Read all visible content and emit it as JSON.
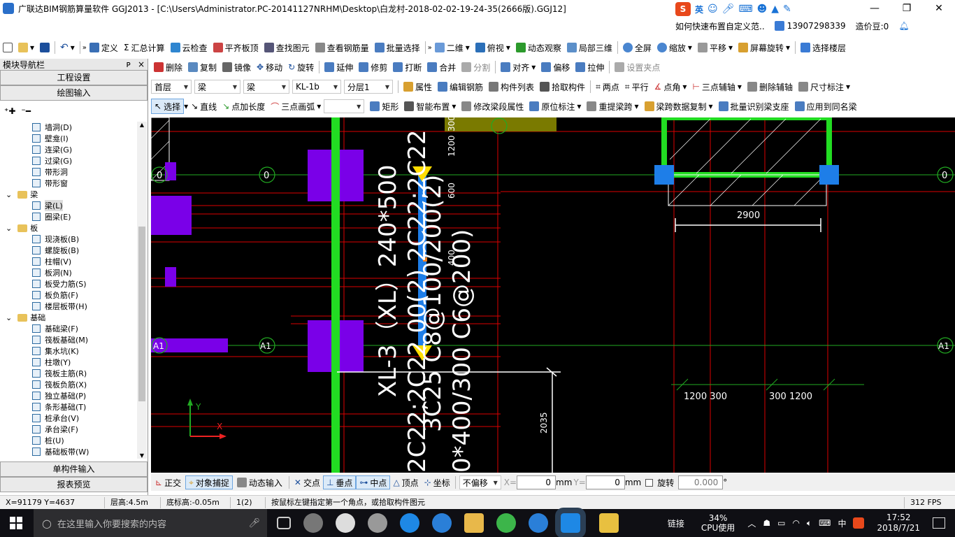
{
  "window": {
    "title": "广联达BIM钢筋算量软件 GGJ2013 - [C:\\Users\\Administrator.PC-20141127NRHM\\Desktop\\白龙村-2018-02-02-19-24-35(2666版).GGJ12]",
    "min": "—",
    "max": "❐",
    "close": "✕"
  },
  "ime": {
    "logo": "S",
    "lang": "英"
  },
  "hint": {
    "text": "如何快速布置自定义范..",
    "phone": "13907298339",
    "bean": "造价豆:0"
  },
  "toolbar1": [
    "定义",
    "汇总计算",
    "云检查",
    "平齐板顶",
    "查找图元",
    "查看钢筋量",
    "批量选择",
    "二维",
    "俯视",
    "动态观察",
    "局部三维",
    "全屏",
    "缩放",
    "平移",
    "屏幕旋转",
    "选择楼层"
  ],
  "toolbar2": [
    "删除",
    "复制",
    "镜像",
    "移动",
    "旋转",
    "延伸",
    "修剪",
    "打断",
    "合并",
    "分割",
    "对齐",
    "偏移",
    "拉伸",
    "设置夹点"
  ],
  "toolbar3": {
    "floor": "首层",
    "cat": "梁",
    "type": "梁",
    "name": "KL-1b",
    "layer": "分层1",
    "items": [
      "属性",
      "编辑钢筋",
      "构件列表",
      "拾取构件",
      "两点",
      "平行",
      "点角",
      "三点辅轴",
      "删除辅轴",
      "尺寸标注"
    ]
  },
  "toolbar4": [
    "选择",
    "直线",
    "点加长度",
    "三点画弧",
    "矩形",
    "智能布置",
    "修改梁段属性",
    "原位标注",
    "重提梁跨",
    "梁跨数据复制",
    "批量识别梁支座",
    "应用到同名梁"
  ],
  "panel": {
    "title": "模块导航栏",
    "pin": "ᴘ",
    "close": "×",
    "btn1": "工程设置",
    "btn2": "绘图输入",
    "btn3": "单构件输入",
    "btn4": "报表预览",
    "tree": [
      {
        "t": "墙洞(D)",
        "lv": 2
      },
      {
        "t": "壁龛(I)",
        "lv": 2
      },
      {
        "t": "连梁(G)",
        "lv": 2
      },
      {
        "t": "过梁(G)",
        "lv": 2
      },
      {
        "t": "带形洞",
        "lv": 2
      },
      {
        "t": "带形窗",
        "lv": 2
      },
      {
        "t": "梁",
        "lv": 1
      },
      {
        "t": "梁(L)",
        "lv": 2,
        "sel": true
      },
      {
        "t": "圈梁(E)",
        "lv": 2
      },
      {
        "t": "板",
        "lv": 1
      },
      {
        "t": "现浇板(B)",
        "lv": 2
      },
      {
        "t": "螺旋板(B)",
        "lv": 2
      },
      {
        "t": "柱帽(V)",
        "lv": 2
      },
      {
        "t": "板洞(N)",
        "lv": 2
      },
      {
        "t": "板受力筋(S)",
        "lv": 2
      },
      {
        "t": "板负筋(F)",
        "lv": 2
      },
      {
        "t": "楼层板带(H)",
        "lv": 2
      },
      {
        "t": "基础",
        "lv": 1
      },
      {
        "t": "基础梁(F)",
        "lv": 2
      },
      {
        "t": "筏板基础(M)",
        "lv": 2
      },
      {
        "t": "集水坑(K)",
        "lv": 2
      },
      {
        "t": "柱墩(Y)",
        "lv": 2
      },
      {
        "t": "筏板主筋(R)",
        "lv": 2
      },
      {
        "t": "筏板负筋(X)",
        "lv": 2
      },
      {
        "t": "独立基础(P)",
        "lv": 2
      },
      {
        "t": "条形基础(T)",
        "lv": 2
      },
      {
        "t": "桩承台(V)",
        "lv": 2
      },
      {
        "t": "承台梁(F)",
        "lv": 2
      },
      {
        "t": "桩(U)",
        "lv": 2
      },
      {
        "t": "基础板带(W)",
        "lv": 2
      }
    ]
  },
  "canvas": {
    "axis0": "0",
    "axisA1": "A1",
    "dim2900": "2900",
    "dim2035": "2035",
    "dimL": "1200 300",
    "dimR": "300 1200",
    "dim1200": "1200",
    "dim300": "300",
    "dim600": "600",
    "dim400": "400",
    "beamTxt1": "XL-3（XL）240*500",
    "beamTxt2": "2C22;2C22 00(2) 2C22;2C22",
    "beamTxt3": "3C25 C8@100/200(2)",
    "beamTxt4": "0*400/300 C6@200)",
    "axisY": "Y",
    "axisX": "X"
  },
  "status": {
    "items": [
      "正交",
      "对象捕捉",
      "动态输入",
      "交点",
      "垂点",
      "中点",
      "顶点",
      "坐标"
    ],
    "offset": "不偏移",
    "xlabel": "X=",
    "xval": "0",
    "mm": "mm",
    "ylabel": "Y=",
    "yval": "0",
    "rot": "旋转",
    "rotval": "0.000",
    "deg": "°"
  },
  "bottom": {
    "coords": "X=91179 Y=4637",
    "height": "层高:4.5m",
    "base": "底标高:-0.05m",
    "count": "1(2)",
    "msg": "按鼠标左键指定第一个角点，或拾取构件图元",
    "fps": "312 FPS"
  },
  "taskbar": {
    "search": "在这里输入你要搜索的内容",
    "link": "链接",
    "cpu": "34%",
    "cpuLabel": "CPU使用",
    "lang": "中",
    "time": "17:52",
    "date": "2018/7/21"
  }
}
